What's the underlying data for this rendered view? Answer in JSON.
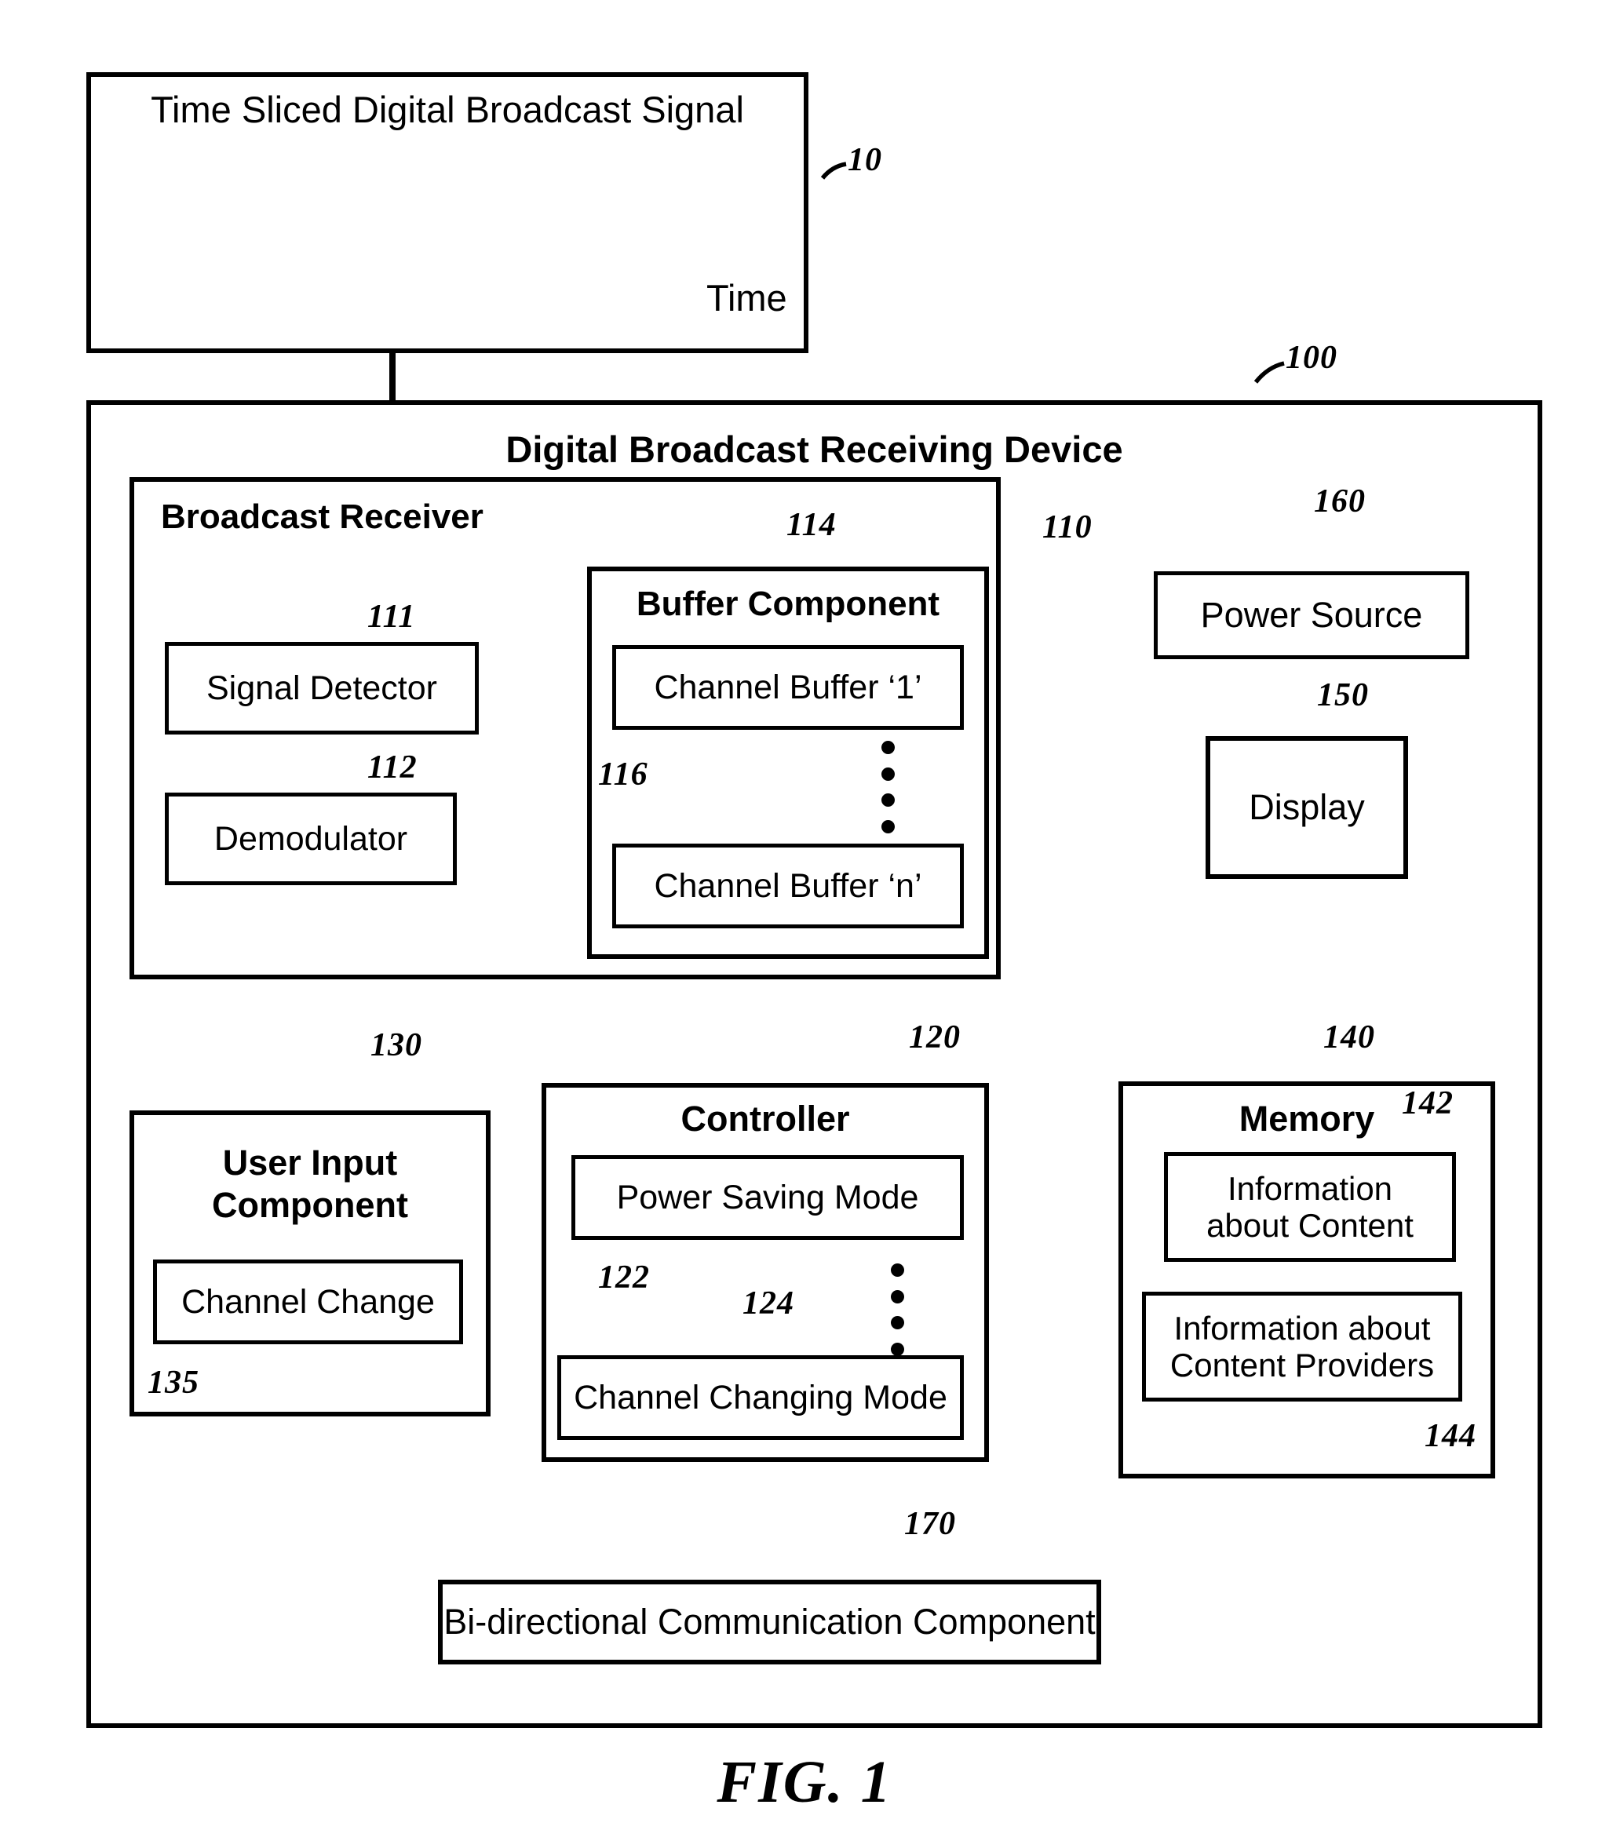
{
  "figure": {
    "caption": "FIG. 1"
  },
  "signal_box": {
    "title": "Time Sliced Digital Broadcast Signal",
    "ref": "10",
    "axis_label": "Time"
  },
  "device": {
    "title": "Digital Broadcast Receiving Device",
    "ref": "100"
  },
  "broadcast_receiver": {
    "title": "Broadcast Receiver",
    "ref": "110",
    "signal_detector": {
      "label": "Signal Detector",
      "ref": "111"
    },
    "demodulator": {
      "label": "Demodulator",
      "ref": "112"
    },
    "buffer_component": {
      "title": "Buffer Component",
      "ref": "114",
      "buffers_ref": "116",
      "buffers": [
        {
          "label": "Channel Buffer ‘1’"
        },
        {
          "label": "Channel Buffer ‘n’"
        }
      ]
    }
  },
  "power_source": {
    "label": "Power Source",
    "ref": "160"
  },
  "display": {
    "label": "Display",
    "ref": "150"
  },
  "controller": {
    "title": "Controller",
    "ref": "120",
    "modes": [
      {
        "label": "Power Saving Mode",
        "ref": "122"
      },
      {
        "label": "Channel Changing Mode",
        "ref": "124"
      }
    ]
  },
  "user_input": {
    "title_line1": "User Input",
    "title_line2": "Component",
    "ref": "130",
    "channel_change": {
      "label": "Channel Change",
      "ref": "135"
    }
  },
  "memory": {
    "title": "Memory",
    "ref": "140",
    "items": [
      {
        "line1": "Information",
        "line2": "about Content",
        "ref": "142"
      },
      {
        "line1": "Information about",
        "line2": "Content Providers",
        "ref": "144"
      }
    ]
  },
  "bidirectional": {
    "label": "Bi-directional Communication Component",
    "ref": "170"
  }
}
